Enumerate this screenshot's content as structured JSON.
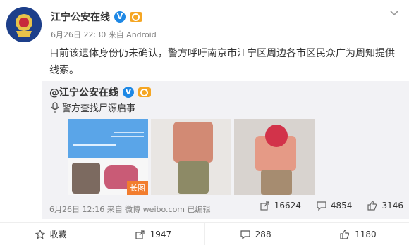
{
  "post": {
    "author": "江宁公安在线",
    "meta": "6月26日 22:30 来自 Android",
    "text": "目前该遗体身份仍未确认，警方呼吁南京市江宁区周边各市区民众广为周知提供线索。"
  },
  "repost": {
    "author": "@江宁公安在线",
    "text": "警方查找尸源启事",
    "long_tag": "长图",
    "meta": "6月26日 12:16 来自 微博 weibo.com  已编辑",
    "actions": [
      {
        "icon": "share-icon",
        "count": "16624"
      },
      {
        "icon": "comment-icon",
        "count": "4854"
      },
      {
        "icon": "like-icon",
        "count": "3146"
      }
    ]
  },
  "footer": [
    {
      "icon": "star-icon",
      "label": "收藏"
    },
    {
      "icon": "share-icon",
      "label": "1947"
    },
    {
      "icon": "comment-icon",
      "label": "288"
    },
    {
      "icon": "like-icon",
      "label": "1180"
    }
  ],
  "colors": {
    "link": "#333333",
    "vip": "#f5a623",
    "verified": "#1e88e5",
    "tag": "#f27d2e"
  }
}
